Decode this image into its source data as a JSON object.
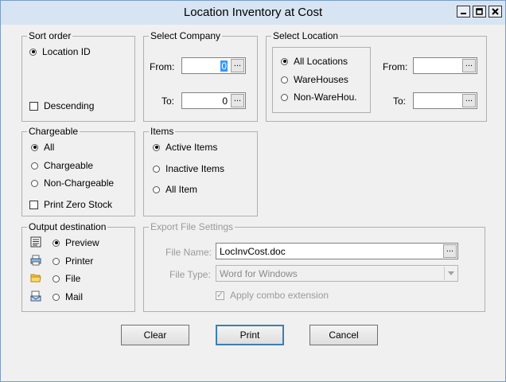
{
  "window": {
    "title": "Location Inventory at Cost"
  },
  "sort_order": {
    "legend": "Sort order",
    "option": "Location ID",
    "descending": "Descending"
  },
  "select_company": {
    "legend": "Select Company",
    "from_label": "From:",
    "to_label": "To:",
    "from_value": "0",
    "to_value": "0",
    "dots": "..."
  },
  "select_location": {
    "legend": "Select Location",
    "options": [
      "All Locations",
      "WareHouses",
      "Non-WareHou."
    ],
    "from_label": "From:",
    "to_label": "To:",
    "dots": "..."
  },
  "chargeable": {
    "legend": "Chargeable",
    "options": [
      "All",
      "Chargeable",
      "Non-Chargeable"
    ],
    "print_zero": "Print Zero Stock"
  },
  "items": {
    "legend": "Items",
    "options": [
      "Active Items",
      "Inactive Items",
      "All Item"
    ]
  },
  "output": {
    "legend": "Output destination",
    "options": [
      "Preview",
      "Printer",
      "File",
      "Mail"
    ]
  },
  "export": {
    "legend": "Export  File Settings",
    "file_name_label": "File Name:",
    "file_name": "LocInvCost.doc",
    "file_type_label": "File Type:",
    "file_type": "Word for Windows",
    "apply_combo": "Apply combo extension",
    "dots": "..."
  },
  "buttons": {
    "clear": "Clear",
    "print": "Print",
    "cancel": "Cancel"
  }
}
